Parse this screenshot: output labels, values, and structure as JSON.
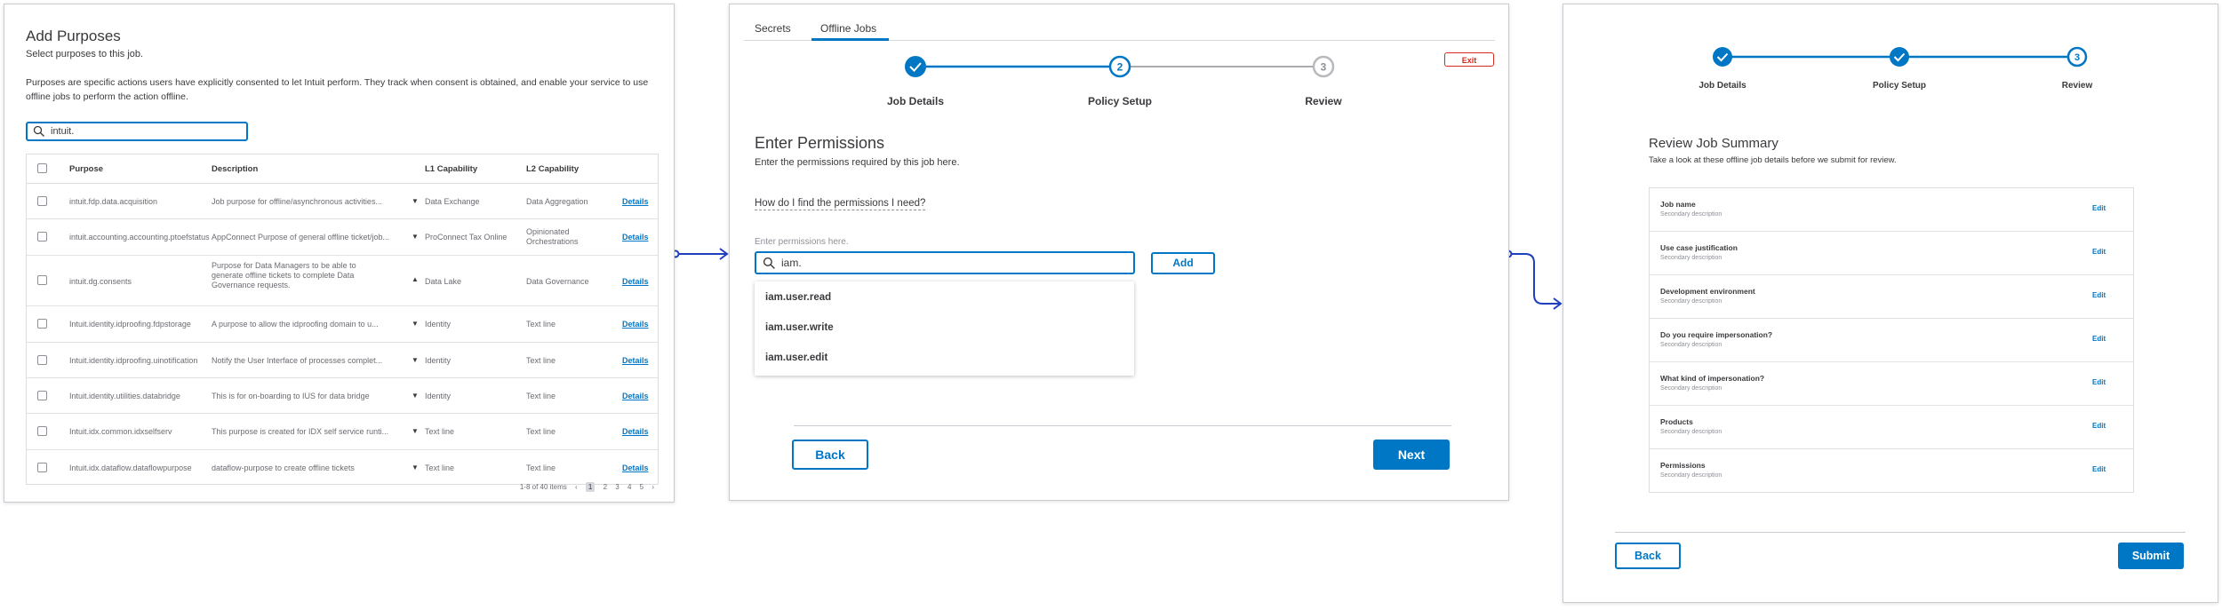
{
  "colors": {
    "accent": "#0077c5",
    "danger": "#d52b1e",
    "border": "#dcdde0",
    "muted": "#8d9096",
    "text": "#393a3d"
  },
  "add_purposes": {
    "title": "Add Purposes",
    "subtitle": "Select purposes to this job.",
    "intro": "Purposes are specific actions users have explicitly consented to let Intuit perform. They track when consent is obtained, and enable your service to use offline jobs to perform the action offline.",
    "search_value": "intuit.",
    "columns": [
      "Purpose",
      "Description",
      "L1 Capability",
      "L2 Capability"
    ],
    "rows": [
      {
        "purpose": "intuit.fdp.data.acquisition",
        "description": "Job purpose for offline/asynchronous activities...",
        "l1": "Data Exchange",
        "l2": "Data Aggregation",
        "action": "Details",
        "expanded": false
      },
      {
        "purpose": "intuit.accounting.accounting.ptoefstatus",
        "description": "AppConnect Purpose of general offline ticket/job...",
        "l1": "ProConnect Tax Online",
        "l2": "Opinionated Orchestrations",
        "action": "Details",
        "expanded": false
      },
      {
        "purpose": "intuit.dg.consents",
        "description": "Purpose for Data Managers to be able to generate offline tickets to complete Data Governance requests.",
        "l1": "Data Lake",
        "l2": "Data Governance",
        "action": "Details",
        "expanded": true
      },
      {
        "purpose": "Intuit.identity.idproofing.fdpstorage",
        "description": "A purpose to allow the idproofing domain to u...",
        "l1": "Identity",
        "l2": "Text line",
        "action": "Details",
        "expanded": false
      },
      {
        "purpose": "Intuit.identity.idproofing.uinotification",
        "description": "Notify the User Interface of processes complet...",
        "l1": "Identity",
        "l2": "Text line",
        "action": "Details",
        "expanded": false
      },
      {
        "purpose": "Intuit.identity.utilities.databridge",
        "description": "This is for on-boarding to IUS for data bridge",
        "l1": "Identity",
        "l2": "Text line",
        "action": "Details",
        "expanded": false
      },
      {
        "purpose": "Intuit.idx.common.idxselfserv",
        "description": "This purpose is created for IDX self service runti...",
        "l1": "Text line",
        "l2": "Text line",
        "action": "Details",
        "expanded": false
      },
      {
        "purpose": "Intuit.idx.dataflow.dataflowpurpose",
        "description": "dataflow-purpose to create offline tickets",
        "l1": "Text line",
        "l2": "Text line",
        "action": "Details",
        "expanded": false
      }
    ],
    "pagination": {
      "range": "1-8 of 40 items",
      "prev": "‹",
      "next": "›",
      "pages": [
        "1",
        "2",
        "3",
        "4",
        "5"
      ],
      "current": "1"
    }
  },
  "enter_permissions": {
    "tabs": [
      "Secrets",
      "Offline Jobs"
    ],
    "active_tab": "Offline Jobs",
    "exit_label": "Exit",
    "steps": [
      {
        "label": "Job Details",
        "state": "done",
        "number": "1"
      },
      {
        "label": "Policy Setup",
        "state": "current",
        "number": "2"
      },
      {
        "label": "Review",
        "state": "upcoming",
        "number": "3"
      }
    ],
    "title": "Enter Permissions",
    "subtitle": "Enter the permissions required by this job here.",
    "help_link": "How do I find the permissions I need?",
    "input_hint": "Enter permissions here.",
    "input_value": "iam.",
    "add_label": "Add",
    "suggestions": [
      "iam.user.read",
      "iam.user.write",
      "iam.user.edit"
    ],
    "back_label": "Back",
    "next_label": "Next"
  },
  "review": {
    "steps": [
      {
        "label": "Job Details",
        "state": "done",
        "number": "1"
      },
      {
        "label": "Policy Setup",
        "state": "done",
        "number": "2"
      },
      {
        "label": "Review",
        "state": "current",
        "number": "3"
      }
    ],
    "title": "Review Job Summary",
    "subtitle": "Take a look at these offline job details before we submit for review.",
    "items": [
      {
        "title": "Job name",
        "desc": "Secondary description",
        "action": "Edit"
      },
      {
        "title": "Use case justification",
        "desc": "Secondary description",
        "action": "Edit"
      },
      {
        "title": "Development environment",
        "desc": "Secondary description",
        "action": "Edit"
      },
      {
        "title": "Do you require impersonation?",
        "desc": "Secondary description",
        "action": "Edit"
      },
      {
        "title": "What kind of impersonation?",
        "desc": "Secondary description",
        "action": "Edit"
      },
      {
        "title": "Products",
        "desc": "Secondary description",
        "action": "Edit"
      },
      {
        "title": "Permissions",
        "desc": "Secondary description",
        "action": "Edit"
      }
    ],
    "back_label": "Back",
    "submit_label": "Submit"
  }
}
